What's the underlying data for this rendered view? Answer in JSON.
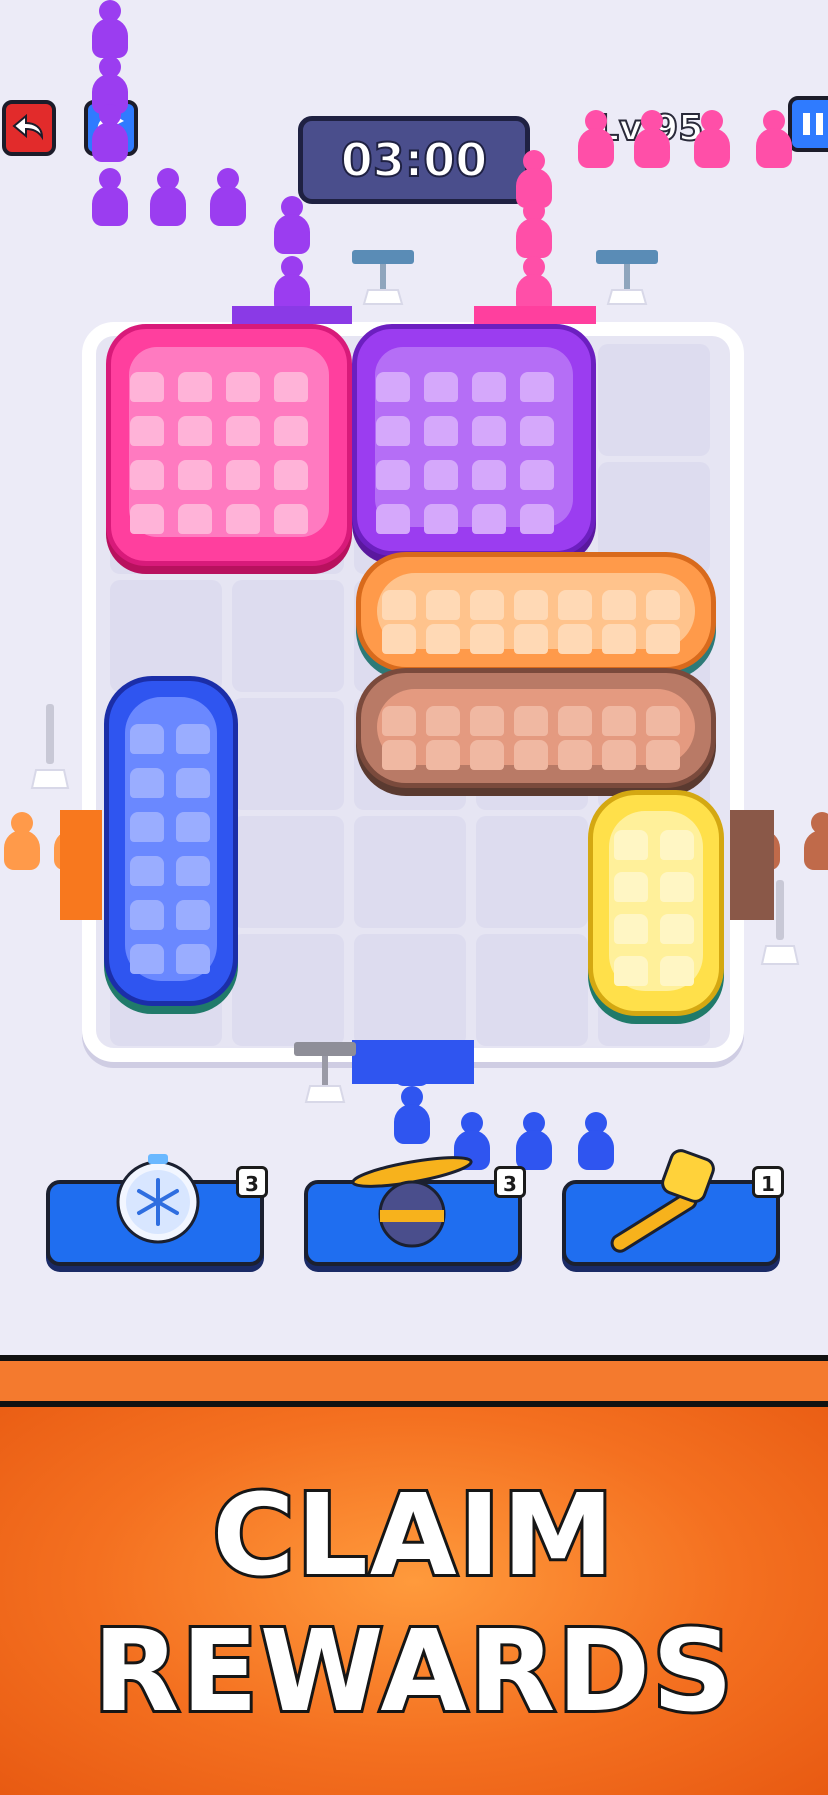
{
  "hud": {
    "timer": "03:00",
    "level": "Lv.95"
  },
  "icons": {
    "back": "undo-arrow-icon",
    "restart": "restart-icon",
    "pause": "pause-icon"
  },
  "boosters": [
    {
      "name": "freeze",
      "icon": "snowflake-clock-icon",
      "count": "3"
    },
    {
      "name": "helicopter",
      "icon": "propeller-ball-icon",
      "count": "3"
    },
    {
      "name": "hammer",
      "icon": "hammer-icon",
      "count": "1"
    }
  ],
  "banner": {
    "line1": "CLAIM",
    "line2": "REWARDS"
  },
  "colors": {
    "pink": "#ff4fa8",
    "purple": "#9b3df0",
    "orange": "#ff9a4a",
    "brown": "#c06a4a",
    "blue": "#2f55f0",
    "yellow": "#ffe04a"
  }
}
